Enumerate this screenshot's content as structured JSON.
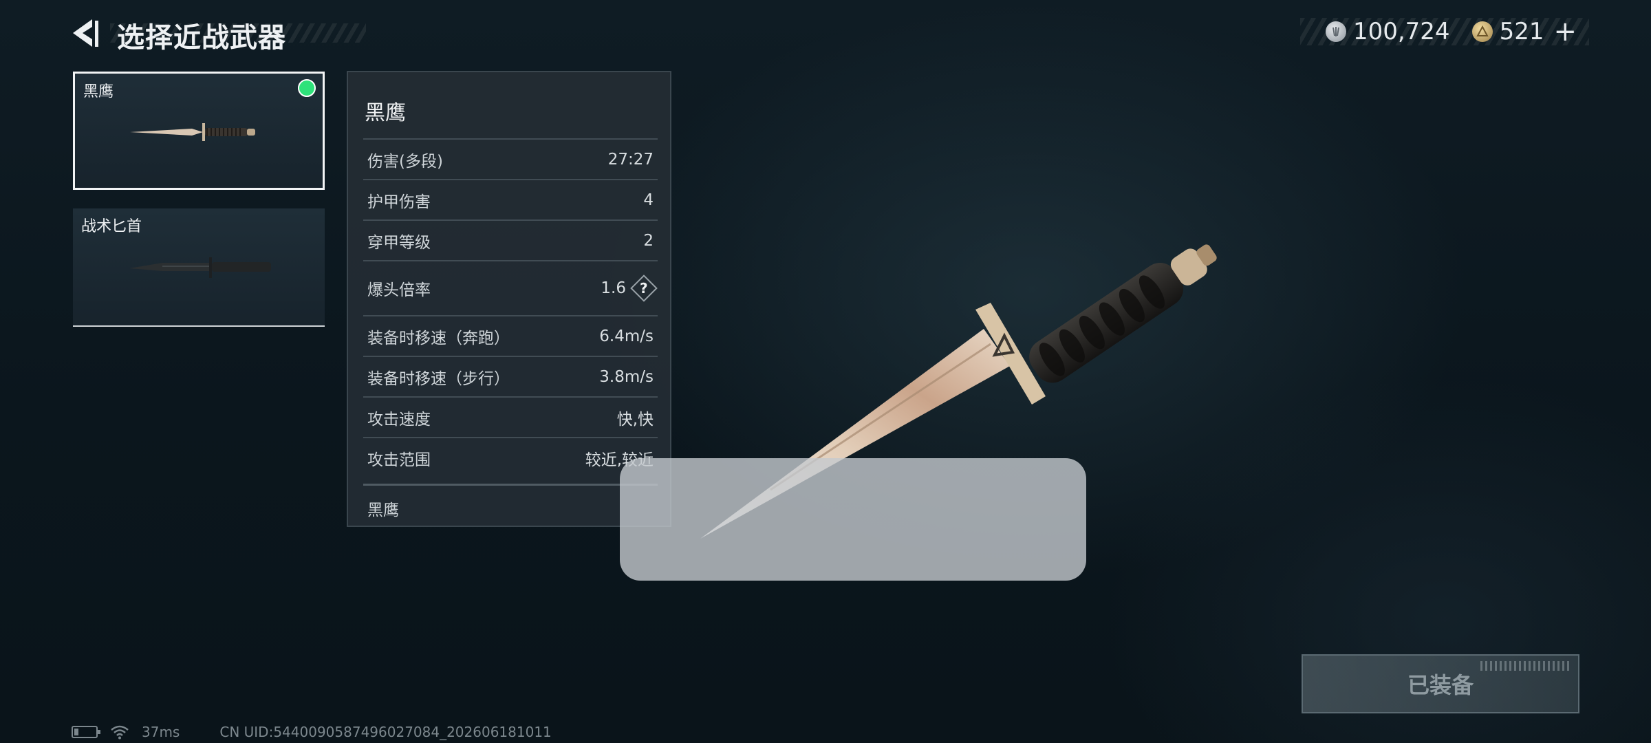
{
  "header": {
    "title": "选择近战武器"
  },
  "currency": {
    "silver": "100,724",
    "gold": "521",
    "plus": "+"
  },
  "weapons": [
    {
      "name": "黑鹰",
      "selected": true,
      "equipped": true
    },
    {
      "name": "战术匕首",
      "selected": false,
      "equipped": false
    }
  ],
  "stats": {
    "title": "黑鹰",
    "rows": [
      {
        "label": "伤害(多段)",
        "value": "27:27"
      },
      {
        "label": "护甲伤害",
        "value": "4"
      },
      {
        "label": "穿甲等级",
        "value": "2"
      },
      {
        "label": "爆头倍率",
        "value": "1.6",
        "help": "?"
      },
      {
        "label": "装备时移速（奔跑）",
        "value": "6.4m/s"
      },
      {
        "label": "装备时移速（步行）",
        "value": "3.8m/s"
      },
      {
        "label": "攻击速度",
        "value": "快,快"
      },
      {
        "label": "攻击范围",
        "value": "较近,较近"
      }
    ],
    "footer": "黑鹰"
  },
  "equip_button": {
    "label": "已装备"
  },
  "status_bar": {
    "ping": "37ms",
    "uid": "CN UID:5440090587496027084_202606181011"
  },
  "colors": {
    "equipped_indicator": "#2ee27a",
    "background": "#0c1820"
  },
  "icons": [
    "back-arrow-icon",
    "silver-coin-icon",
    "gold-coin-icon",
    "help-icon",
    "battery-icon",
    "wifi-icon"
  ]
}
